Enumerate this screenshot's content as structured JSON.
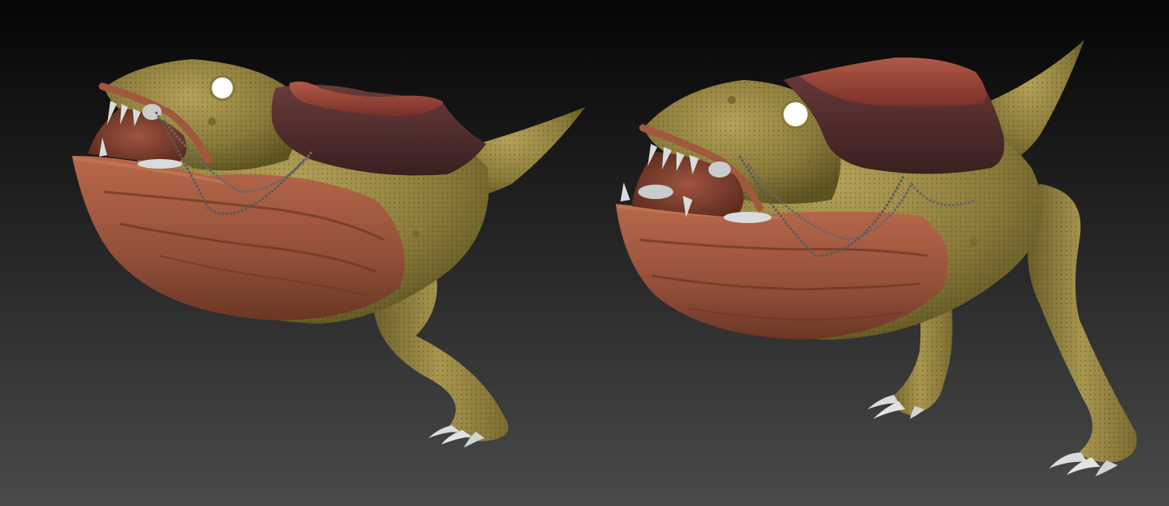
{
  "scene": {
    "background": {
      "top": "#050505",
      "mid": "#2a2a2a",
      "bottom": "#4a4a4a"
    },
    "colors": {
      "skin_light": "#a8964e",
      "skin_mid": "#8a7a3a",
      "skin_dark": "#5c5220",
      "armor_light": "#b8684a",
      "armor_mid": "#94503a",
      "armor_dark": "#6a3624",
      "saddle_dark": "#4a2a2a",
      "saddle_light": "#8a4038",
      "teeth": "#d8dcdc",
      "rope": "#5a5a5a",
      "eye": "#ffffff"
    },
    "models": [
      {
        "name": "creature-model-left",
        "view": "side-left"
      },
      {
        "name": "creature-model-right",
        "view": "three-quarter-left"
      }
    ]
  }
}
